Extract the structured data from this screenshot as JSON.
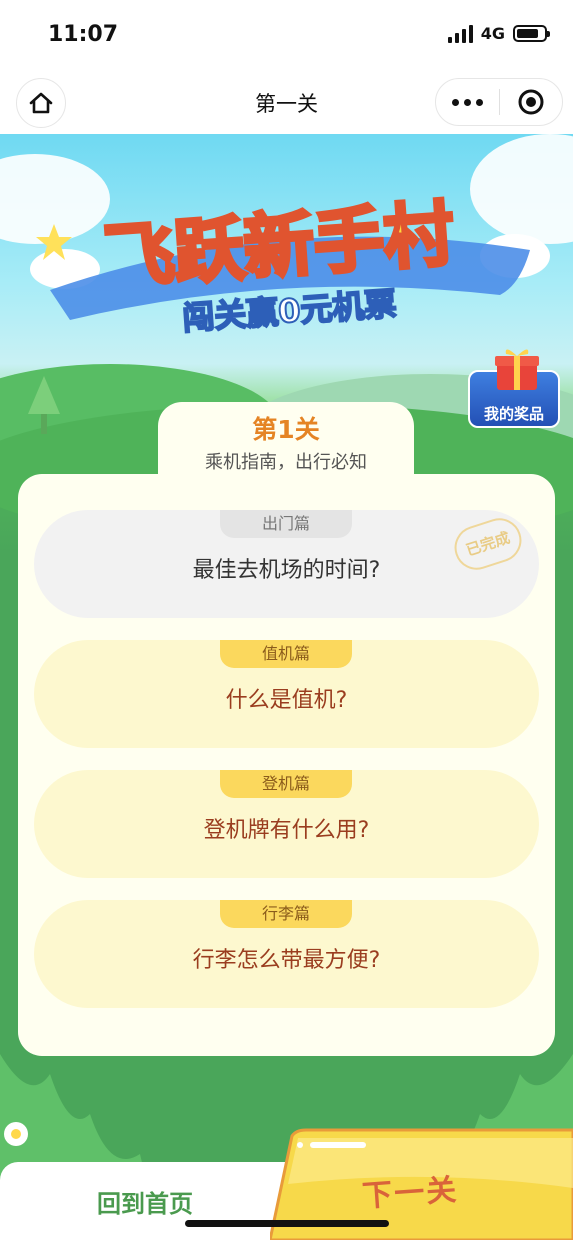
{
  "status": {
    "time": "11:07",
    "network": "4G"
  },
  "nav": {
    "title": "第一关"
  },
  "banner": {
    "title": "飞跃新手村",
    "subtitle": "闯关赢0元机票"
  },
  "prizes": {
    "label": "我的奖品"
  },
  "level": {
    "title": "第1关",
    "subtitle": "乘机指南，出行必知"
  },
  "quiz": [
    {
      "tag": "出门篇",
      "question": "最佳去机场的时间?",
      "status": "done",
      "stamp": "已完成"
    },
    {
      "tag": "值机篇",
      "question": "什么是值机?",
      "status": "todo"
    },
    {
      "tag": "登机篇",
      "question": "登机牌有什么用?",
      "status": "todo"
    },
    {
      "tag": "行李篇",
      "question": "行李怎么带最方便?",
      "status": "todo"
    }
  ],
  "bottom": {
    "home_label": "回到首页",
    "next_label": "下一关"
  },
  "colors": {
    "accent_orange": "#e58424",
    "brand_green": "#4aa65a",
    "tag_yellow": "#fbd85d",
    "question_red": "#9a3d1f"
  }
}
